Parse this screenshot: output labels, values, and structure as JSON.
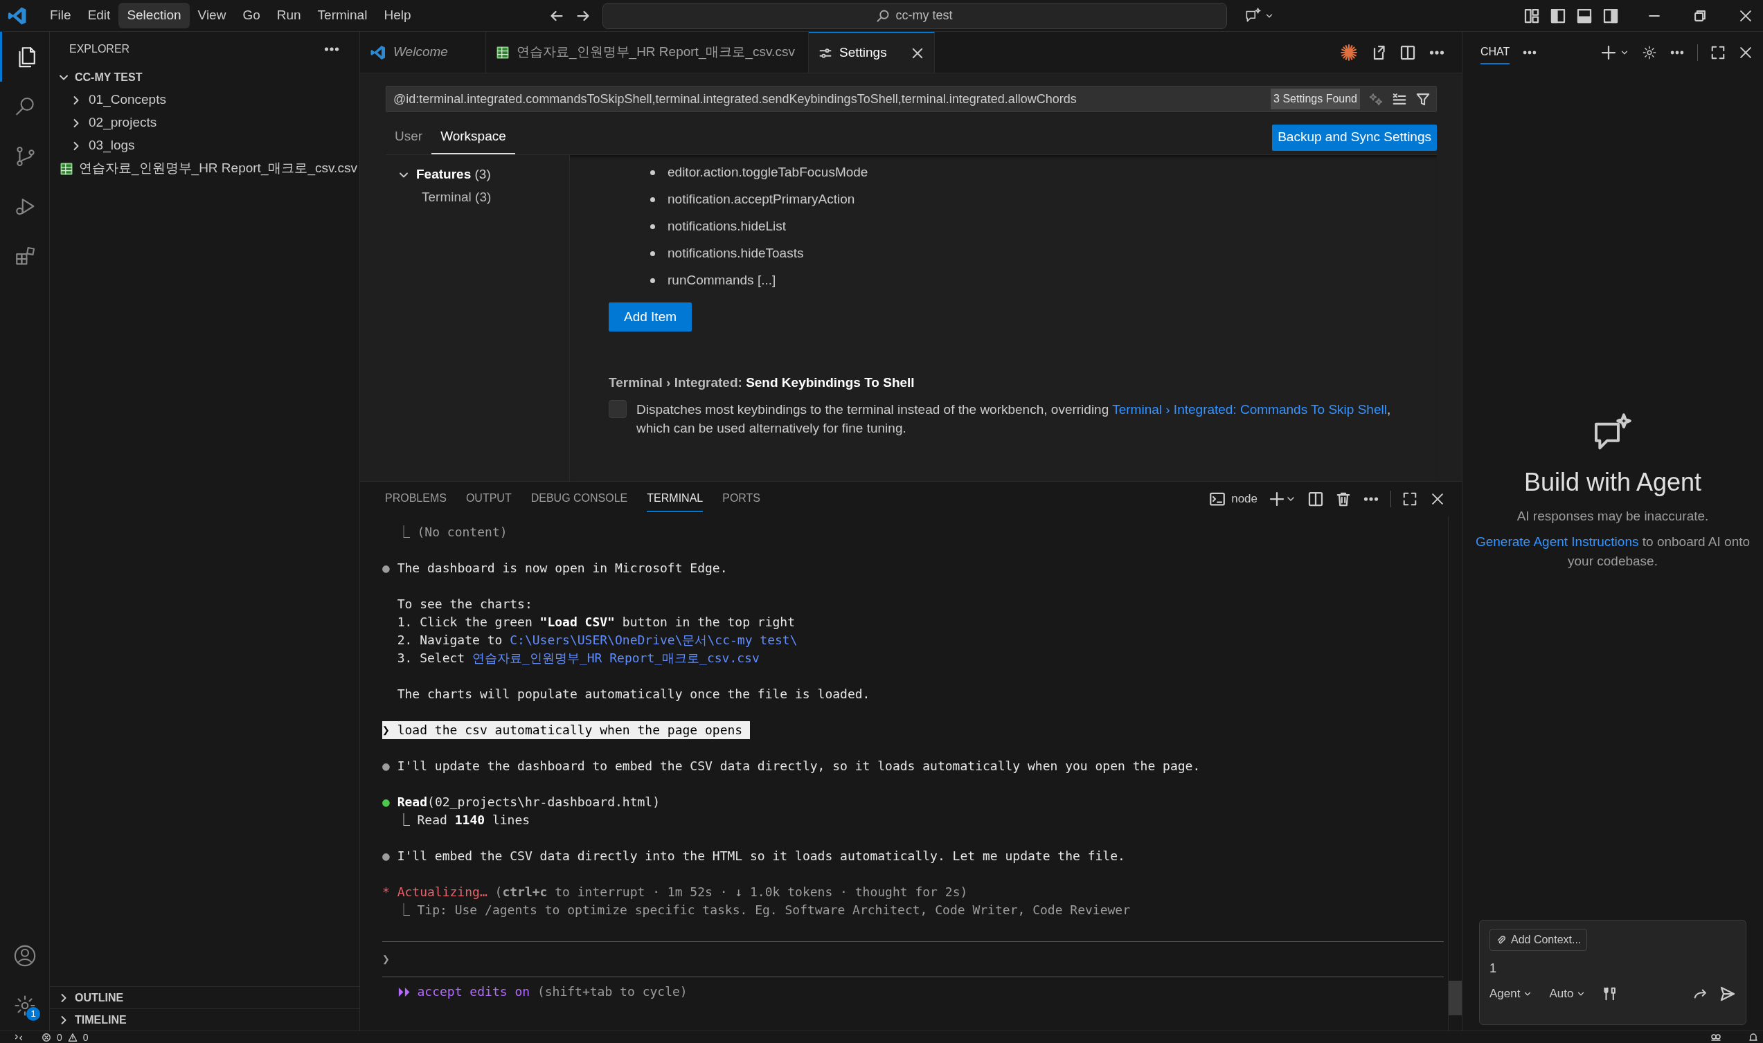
{
  "menu": [
    {
      "label": "File",
      "selected": false
    },
    {
      "label": "Edit",
      "selected": false
    },
    {
      "label": "Selection",
      "selected": true
    },
    {
      "label": "View",
      "selected": false
    },
    {
      "label": "Go",
      "selected": false
    },
    {
      "label": "Run",
      "selected": false
    },
    {
      "label": "Terminal",
      "selected": false
    },
    {
      "label": "Help",
      "selected": false
    }
  ],
  "command_center": {
    "text": "cc-my test"
  },
  "activity_bar": [
    {
      "kind": "files",
      "selected": true
    },
    {
      "kind": "search",
      "selected": false
    },
    {
      "kind": "source-control",
      "selected": false
    },
    {
      "kind": "run-debug",
      "selected": false
    },
    {
      "kind": "extensions",
      "selected": false
    }
  ],
  "manage": {
    "badge": "1"
  },
  "explorer": {
    "title": "EXPLORER",
    "root": {
      "label": "CC-MY TEST",
      "expanded": true,
      "children": [
        {
          "label": "01_Concepts",
          "kind": "folder",
          "expanded": false
        },
        {
          "label": "02_projects",
          "kind": "folder",
          "expanded": false
        },
        {
          "label": "03_logs",
          "kind": "folder",
          "expanded": false
        },
        {
          "label": "연습자료_인원명부_HR Report_매크로_csv.csv",
          "kind": "spreadsheet"
        }
      ]
    },
    "sections": [
      {
        "label": "OUTLINE",
        "expanded": false
      },
      {
        "label": "TIMELINE",
        "expanded": false
      }
    ]
  },
  "editor_tabs": [
    {
      "label": "Welcome",
      "kind": "welcome",
      "preview": true,
      "selected": false
    },
    {
      "label": "연습자료_인원명부_HR Report_매크로_csv.csv",
      "kind": "spreadsheet",
      "preview": false,
      "selected": false
    },
    {
      "label": "Settings",
      "kind": "settings",
      "preview": false,
      "selected": true
    }
  ],
  "settings": {
    "query": "@id:terminal.integrated.commandsToSkipShell,terminal.integrated.sendKeybindingsToShell,terminal.integrated.allowChords",
    "result_count": "3 Settings Found",
    "scopes": [
      {
        "label": "User",
        "selected": false
      },
      {
        "label": "Workspace",
        "selected": true
      }
    ],
    "sync_button": "Backup and Sync Settings",
    "toc": [
      {
        "label": "Features",
        "count": "(3)",
        "expanded": true,
        "children": [
          {
            "label": "Terminal",
            "count": "(3)"
          }
        ]
      }
    ],
    "list_items": [
      "editor.action.toggleTabFocusMode",
      "notification.acceptPrimaryAction",
      "notifications.hideList",
      "notifications.hideToasts",
      "runCommands [...]"
    ],
    "add_button": "Add Item",
    "setting": {
      "category": "Terminal › Integrated: ",
      "title": "Send Keybindings To Shell",
      "checked": false,
      "description": "Dispatches most keybindings to the terminal instead of the workbench, overriding ",
      "link": "Terminal › Integrated: Commands To Skip Shell",
      "description_end": ", which can be used alternatively for fine tuning."
    }
  },
  "panel": {
    "tabs": [
      {
        "label": "PROBLEMS",
        "selected": false
      },
      {
        "label": "OUTPUT",
        "selected": false
      },
      {
        "label": "DEBUG CONSOLE",
        "selected": false
      },
      {
        "label": "TERMINAL",
        "selected": true
      },
      {
        "label": "PORTS",
        "selected": false
      }
    ],
    "terminal_name": "node",
    "lines": [
      {
        "kind": "text",
        "segments": [
          {
            "text": "  ⎿ (No content)",
            "kind": "dim"
          }
        ]
      },
      {
        "kind": "blank"
      },
      {
        "kind": "text",
        "segments": [
          {
            "text": "● ",
            "kind": "bullet_gray"
          },
          {
            "text": "The dashboard is now open in Microsoft Edge.",
            "kind": "plain"
          }
        ]
      },
      {
        "kind": "blank"
      },
      {
        "kind": "text",
        "segments": [
          {
            "text": "  To see the charts:",
            "kind": "plain"
          }
        ]
      },
      {
        "kind": "text",
        "segments": [
          {
            "text": "  1. Click the green ",
            "kind": "plain"
          },
          {
            "text": "\"Load CSV\"",
            "kind": "bold"
          },
          {
            "text": " button in the top right",
            "kind": "plain"
          }
        ]
      },
      {
        "kind": "text",
        "segments": [
          {
            "text": "  2. Navigate to ",
            "kind": "plain"
          },
          {
            "text": "C:\\Users\\USER\\OneDrive\\문서\\cc-my test\\",
            "kind": "link"
          }
        ]
      },
      {
        "kind": "text",
        "segments": [
          {
            "text": "  3. Select ",
            "kind": "plain"
          },
          {
            "text": "연습자료_인원명부_HR Report_매크로_csv.csv",
            "kind": "link"
          }
        ]
      },
      {
        "kind": "blank"
      },
      {
        "kind": "text",
        "segments": [
          {
            "text": "  The charts will populate automatically once the file is loaded.",
            "kind": "plain"
          }
        ]
      },
      {
        "kind": "blank"
      },
      {
        "kind": "user",
        "segments": [
          {
            "text": "❯ load the csv automatically when the page opens ",
            "kind": "plain"
          }
        ]
      },
      {
        "kind": "blank"
      },
      {
        "kind": "text",
        "segments": [
          {
            "text": "● ",
            "kind": "bullet_gray"
          },
          {
            "text": "I'll update the dashboard to embed the CSV data directly, so it loads automatically when you open the page.",
            "kind": "plain"
          }
        ]
      },
      {
        "kind": "blank"
      },
      {
        "kind": "text",
        "segments": [
          {
            "text": "● ",
            "kind": "bullet_green"
          },
          {
            "text": "Read",
            "kind": "bold"
          },
          {
            "text": "(02_projects\\hr-dashboard.html)",
            "kind": "plain"
          }
        ]
      },
      {
        "kind": "text",
        "segments": [
          {
            "text": "  ⎿ Read ",
            "kind": "plain"
          },
          {
            "text": "1140",
            "kind": "bold"
          },
          {
            "text": " lines",
            "kind": "plain"
          }
        ]
      },
      {
        "kind": "blank"
      },
      {
        "kind": "text",
        "segments": [
          {
            "text": "● ",
            "kind": "bullet_gray"
          },
          {
            "text": "I'll embed the CSV data directly into the HTML so it loads automatically. Let me update the file.",
            "kind": "plain"
          }
        ]
      },
      {
        "kind": "blank"
      },
      {
        "kind": "text",
        "segments": [
          {
            "text": "* Actualizing… ",
            "kind": "error"
          },
          {
            "text": "(",
            "kind": "dim"
          },
          {
            "text": "ctrl+c",
            "kind": "bold_dim"
          },
          {
            "text": " to interrupt · 1m 52s · ↓ 1.0k tokens · thought for 2s)",
            "kind": "dim"
          }
        ]
      },
      {
        "kind": "text",
        "segments": [
          {
            "text": "  ⎿ Tip: Use /agents to optimize specific tasks. Eg. Software Architect, Code Writer, Code Reviewer",
            "kind": "dim"
          }
        ]
      }
    ],
    "input_prompt": "❯",
    "footer": [
      {
        "text": "  ⏵⏵ accept edits on",
        "kind": "accent"
      },
      {
        "text": " (shift+tab to cycle)",
        "kind": "dim"
      }
    ]
  },
  "chat": {
    "title": "CHAT",
    "heading": "Build with Agent",
    "subtitle": "AI responses may be inaccurate.",
    "link": "Generate Agent Instructions",
    "text": " to onboard AI onto your codebase.",
    "add_context": "Add Context...",
    "input_value": "1",
    "mode": "Agent",
    "model": "Auto"
  },
  "status_bar": {
    "errors": "0",
    "warnings": "0"
  }
}
